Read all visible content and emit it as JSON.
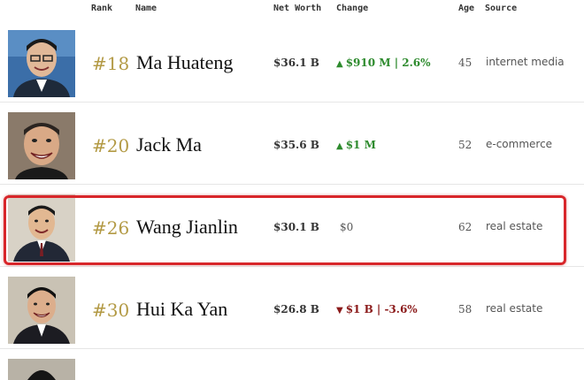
{
  "header": {
    "rank": "Rank",
    "name": "Name",
    "net_worth": "Net Worth",
    "change": "Change",
    "age": "Age",
    "source": "Source"
  },
  "rows": [
    {
      "rank": "#18",
      "name": "Ma Huateng",
      "net_worth": "$36.1 B",
      "change": "$910 M | 2.6%",
      "change_direction": "up",
      "age": "45",
      "source": "internet media"
    },
    {
      "rank": "#20",
      "name": "Jack Ma",
      "net_worth": "$35.6 B",
      "change": "$1 M",
      "change_direction": "up",
      "age": "52",
      "source": "e-commerce"
    },
    {
      "rank": "#26",
      "name": "Wang Jianlin",
      "net_worth": "$30.1 B",
      "change": "$0",
      "change_direction": "none",
      "age": "62",
      "source": "real estate"
    },
    {
      "rank": "#30",
      "name": "Hui Ka Yan",
      "net_worth": "$26.8 B",
      "change": "$1 B | -3.6%",
      "change_direction": "down",
      "age": "58",
      "source": "real estate"
    }
  ],
  "colors": {
    "rank": "#b39a45",
    "up": "#2e8b2e",
    "down": "#8b1a1a",
    "highlight": "#d8262a"
  },
  "icons": {
    "up": "arrow-up-icon",
    "down": "arrow-down-icon"
  }
}
